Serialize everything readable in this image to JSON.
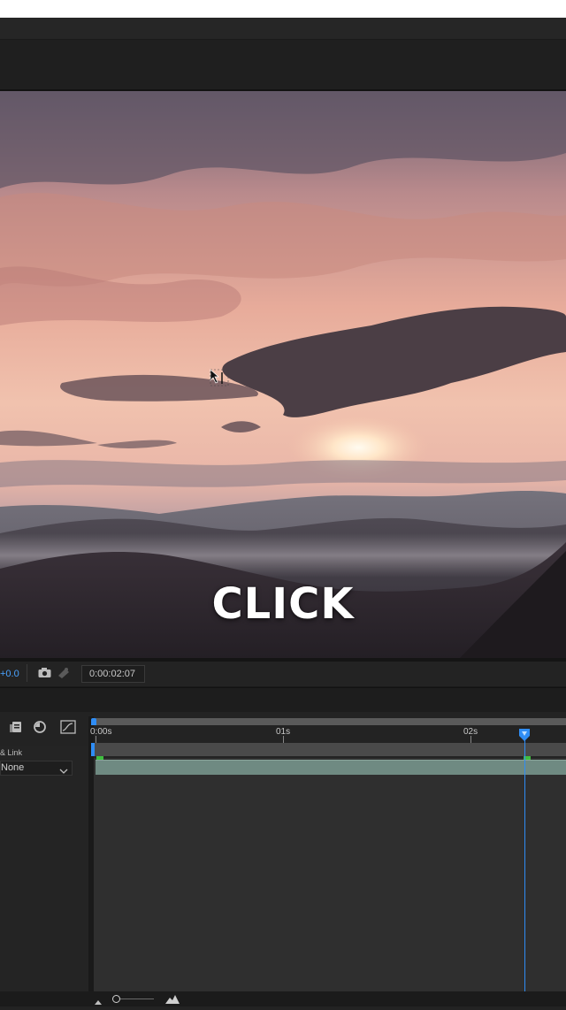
{
  "viewer": {
    "caption": "CLICK"
  },
  "viewer_controls": {
    "exposure_value": "+0.0",
    "timecode": "0:00:02:07",
    "icons": [
      "camera-icon",
      "show-snapshot-icon"
    ]
  },
  "timeline": {
    "toolbar_icons": [
      "solo-icon",
      "motion-blur-icon",
      "graph-editor-icon"
    ],
    "layer_column_header": "& Link",
    "parent_value": "None",
    "ruler": {
      "labels": [
        "0:00s",
        "01s",
        "02s"
      ]
    },
    "current_time_fraction": 0.86
  },
  "colors": {
    "accent_blue": "#2f8df5",
    "layer_bar": "#6f8a82",
    "keyframe_green": "#3fbf3f"
  }
}
